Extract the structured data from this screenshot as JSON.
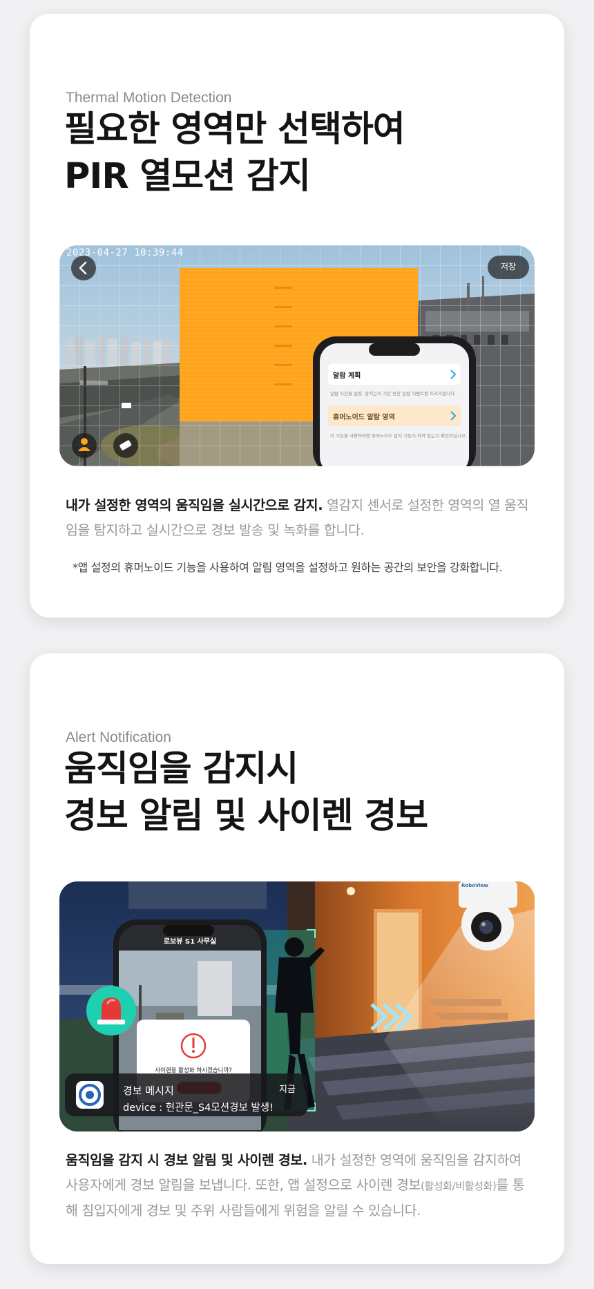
{
  "section1": {
    "eyebrow": "Thermal Motion Detection",
    "title_line1": "필요한 영역만 선택하여",
    "title_line2": "PIR 열모션 감지",
    "camera": {
      "timestamp": "2023-04-27 10:39:44",
      "save_label": "저장"
    },
    "phone": {
      "row1_title": "알람 계획",
      "row1_desc": "알람 시간을 설정. 장치는이 기간 동안 알람 이벤트를 트리거합니다",
      "row2_title": "휴머노이드 알람 영역",
      "row2_desc": "이 기능을 사용하려면 휴머노이드 감지 기능이 켜져 있는지 확인하십시오."
    },
    "desc_bold": "내가 설정한 영역의 움직임을 실시간으로 감지.",
    "desc_rest": " 열감지 센서로 설정한 영역의 열 움직임을 탐지하고 실시간으로 경보 발송 및 녹화를 합니다.",
    "note": "*앱 설정의 휴머노이드 기능을 사용하여 알림 영역을 설정하고 원하는 공간의 보안을 강화합니다."
  },
  "section2": {
    "eyebrow": "Alert Notification",
    "title_line1": "움직임을 감지시",
    "title_line2": "경보 알림 및 사이렌 경보",
    "phone": {
      "title": "로보뷰 S1 사무실",
      "dialog_text": "사이렌을 활성화 하시겠습니까?"
    },
    "camera_brand": "RoboView",
    "notification": {
      "title": "경보 메시지",
      "body": "device : 현관문_S4모션경보 발생!",
      "time": "지금"
    },
    "desc_bold": "움직임을 감지 시 경보 알림 및 사이렌 경보.",
    "desc_rest1": " 내가 설정한 영역에 움직임을 감지하여 사용자에게 경보 알림을 보냅니다. 또한, 앱 설정으로 사이렌 경보",
    "desc_small": "(활성화/비활성화)",
    "desc_rest2": "를 통해 침입자에게 경보 및 주위 사람들에게 위험을 알릴 수 있습니다."
  },
  "colors": {
    "page_bg": "#f1f1f3",
    "card_bg": "#ffffff",
    "orange_zone": "#ffa31a",
    "siren_teal": "#1fd0b0",
    "alert_red": "#e53935"
  }
}
